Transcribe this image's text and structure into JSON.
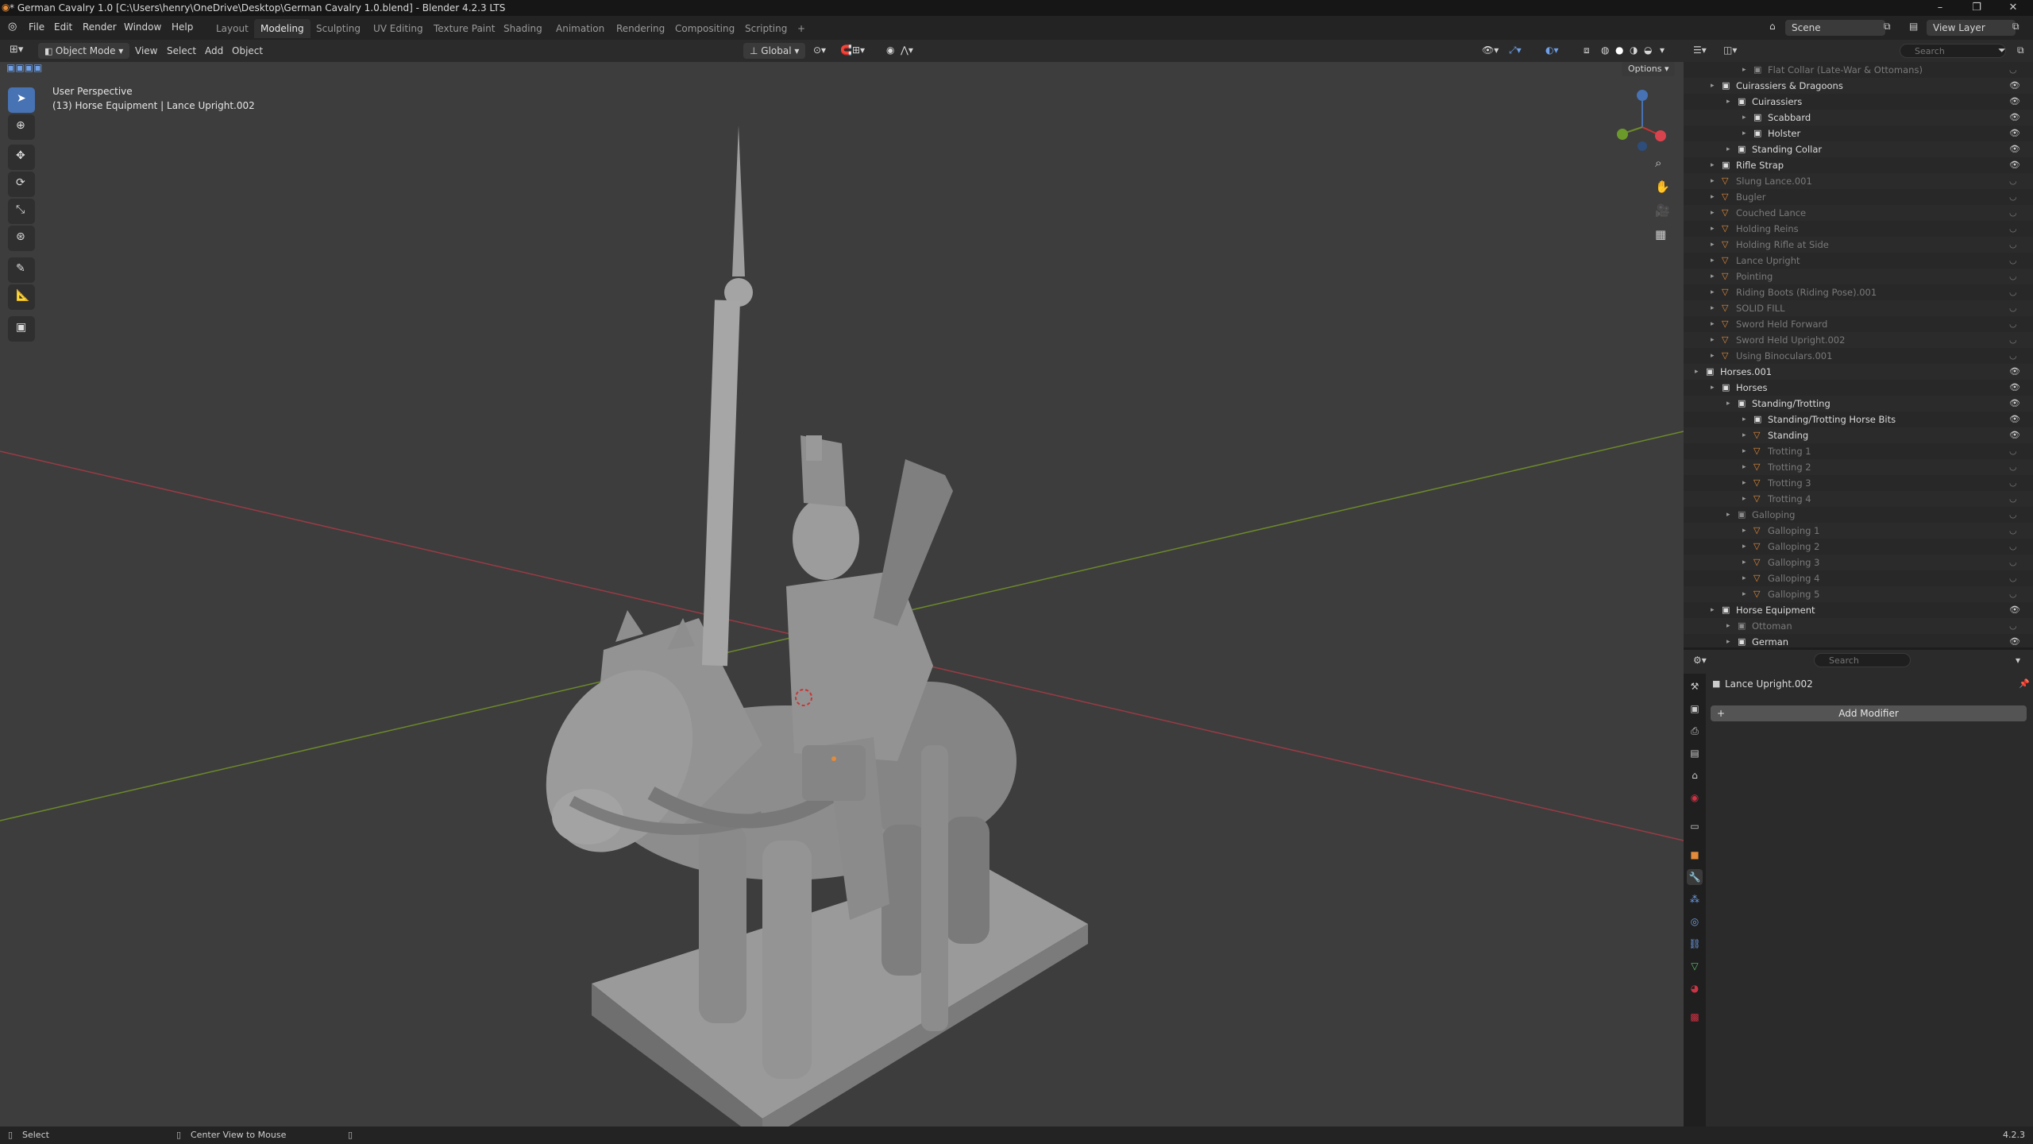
{
  "window": {
    "title": "* German Cavalry 1.0 [C:\\Users\\henry\\OneDrive\\Desktop\\German Cavalry 1.0.blend] - Blender 4.2.3 LTS"
  },
  "menubar": {
    "items": [
      "File",
      "Edit",
      "Render",
      "Window",
      "Help"
    ]
  },
  "workspaces": [
    "Layout",
    "Modeling",
    "Sculpting",
    "UV Editing",
    "Texture Paint",
    "Shading",
    "Animation",
    "Rendering",
    "Compositing",
    "Scripting",
    "+"
  ],
  "scene": {
    "label": "Scene",
    "view_layer": "View Layer"
  },
  "viewport_header": {
    "mode": "Object Mode",
    "menus": [
      "View",
      "Select",
      "Add",
      "Object"
    ],
    "orientation": "Global",
    "options": "Options"
  },
  "viewport": {
    "info_line1": "User Perspective",
    "info_line2": "(13) Horse Equipment | Lance Upright.002"
  },
  "outliner": {
    "search_placeholder": "Search",
    "rows": [
      {
        "label": "Flat Collar (Late-War & Ottomans)",
        "indent": 3,
        "kind": "collection",
        "dim": true
      },
      {
        "label": "Cuirassiers & Dragoons",
        "indent": 1,
        "kind": "collection",
        "dim": false
      },
      {
        "label": "Cuirassiers",
        "indent": 2,
        "kind": "collection",
        "dim": false
      },
      {
        "label": "Scabbard",
        "indent": 3,
        "kind": "collection",
        "dim": false
      },
      {
        "label": "Holster",
        "indent": 3,
        "kind": "collection",
        "dim": false
      },
      {
        "label": "Standing Collar",
        "indent": 2,
        "kind": "collection",
        "dim": false
      },
      {
        "label": "Rifle Strap",
        "indent": 1,
        "kind": "collection",
        "dim": false
      },
      {
        "label": "Slung Lance.001",
        "indent": 1,
        "kind": "mesh",
        "dim": true
      },
      {
        "label": "Bugler",
        "indent": 1,
        "kind": "mesh",
        "dim": true
      },
      {
        "label": "Couched Lance",
        "indent": 1,
        "kind": "mesh",
        "dim": true
      },
      {
        "label": "Holding Reins",
        "indent": 1,
        "kind": "mesh",
        "dim": true
      },
      {
        "label": "Holding Rifle at Side",
        "indent": 1,
        "kind": "mesh",
        "dim": true
      },
      {
        "label": "Lance Upright",
        "indent": 1,
        "kind": "mesh",
        "dim": true
      },
      {
        "label": "Pointing",
        "indent": 1,
        "kind": "mesh",
        "dim": true
      },
      {
        "label": "Riding Boots (Riding Pose).001",
        "indent": 1,
        "kind": "mesh",
        "dim": true
      },
      {
        "label": "SOLID FILL",
        "indent": 1,
        "kind": "mesh",
        "dim": true
      },
      {
        "label": "Sword Held Forward",
        "indent": 1,
        "kind": "mesh",
        "dim": true
      },
      {
        "label": "Sword Held Upright.002",
        "indent": 1,
        "kind": "mesh",
        "dim": true
      },
      {
        "label": "Using Binoculars.001",
        "indent": 1,
        "kind": "mesh",
        "dim": true
      },
      {
        "label": "Horses.001",
        "indent": 0,
        "kind": "collection",
        "dim": false
      },
      {
        "label": "Horses",
        "indent": 1,
        "kind": "collection",
        "dim": false
      },
      {
        "label": "Standing/Trotting",
        "indent": 2,
        "kind": "collection",
        "dim": false
      },
      {
        "label": "Standing/Trotting Horse Bits",
        "indent": 3,
        "kind": "collection",
        "dim": false
      },
      {
        "label": "Standing",
        "indent": 3,
        "kind": "mesh",
        "dim": false
      },
      {
        "label": "Trotting 1",
        "indent": 3,
        "kind": "mesh",
        "dim": true
      },
      {
        "label": "Trotting 2",
        "indent": 3,
        "kind": "mesh",
        "dim": true
      },
      {
        "label": "Trotting 3",
        "indent": 3,
        "kind": "mesh",
        "dim": true
      },
      {
        "label": "Trotting 4",
        "indent": 3,
        "kind": "mesh",
        "dim": true
      },
      {
        "label": "Galloping",
        "indent": 2,
        "kind": "collection",
        "dim": true
      },
      {
        "label": "Galloping 1",
        "indent": 3,
        "kind": "mesh",
        "dim": true
      },
      {
        "label": "Galloping 2",
        "indent": 3,
        "kind": "mesh",
        "dim": true
      },
      {
        "label": "Galloping 3",
        "indent": 3,
        "kind": "mesh",
        "dim": true
      },
      {
        "label": "Galloping 4",
        "indent": 3,
        "kind": "mesh",
        "dim": true
      },
      {
        "label": "Galloping 5",
        "indent": 3,
        "kind": "mesh",
        "dim": true
      },
      {
        "label": "Horse Equipment",
        "indent": 1,
        "kind": "collection",
        "dim": false
      },
      {
        "label": "Ottoman",
        "indent": 2,
        "kind": "collection",
        "dim": true
      },
      {
        "label": "German",
        "indent": 2,
        "kind": "collection",
        "dim": false
      }
    ]
  },
  "properties": {
    "search_placeholder": "Search",
    "object_name": "Lance Upright.002",
    "add_modifier": "Add Modifier"
  },
  "statusbar": {
    "select": "Select",
    "center_view": "Center View to Mouse",
    "version": "4.2.3"
  },
  "colors": {
    "accent": "#4772b3",
    "mesh_icon": "#e38b3a",
    "data_icon": "#5ec36c",
    "x_axis": "#9a3b45",
    "y_axis": "#6c8a2a"
  }
}
